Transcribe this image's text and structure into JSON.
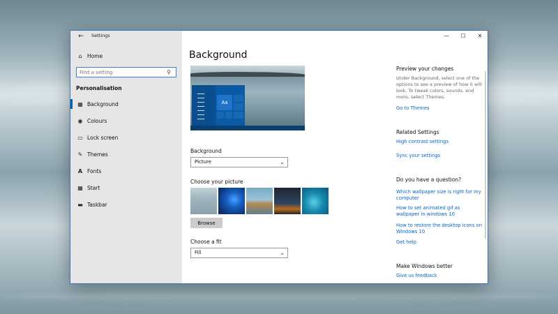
{
  "window": {
    "title": "Settings",
    "back_icon": "back-arrow-icon",
    "controls": [
      "minimize",
      "maximize",
      "close"
    ]
  },
  "sidebar": {
    "home_label": "Home",
    "search_placeholder": "Find a setting",
    "section_title": "Personalisation",
    "items": [
      {
        "label": "Background",
        "icon": "picture-icon",
        "active": true
      },
      {
        "label": "Colours",
        "icon": "palette-icon",
        "active": false
      },
      {
        "label": "Lock screen",
        "icon": "monitor-icon",
        "active": false
      },
      {
        "label": "Themes",
        "icon": "brush-icon",
        "active": false
      },
      {
        "label": "Fonts",
        "icon": "font-icon",
        "active": false
      },
      {
        "label": "Start",
        "icon": "start-grid-icon",
        "active": false
      },
      {
        "label": "Taskbar",
        "icon": "taskbar-icon",
        "active": false
      }
    ]
  },
  "main": {
    "title": "Background",
    "preview_tile_text": "Aa",
    "background_label": "Background",
    "background_value": "Picture",
    "choose_picture_label": "Choose your picture",
    "browse_label": "Browse",
    "fit_label": "Choose a fit",
    "fit_value": "Fill"
  },
  "right": {
    "preview_heading": "Preview your changes",
    "preview_text": "Under Background, select one of the options to see a preview of how it will look. To tweak colors, sounds, and more, select Themes.",
    "go_to_themes": "Go to Themes",
    "related_heading": "Related Settings",
    "high_contrast": "High contrast settings",
    "sync_settings": "Sync your settings",
    "question_heading": "Do you have a question?",
    "q1": "Which wallpaper size is right for my computer",
    "q2": "How to set animated gif as wallpaper in windows 10",
    "q3": "How to restore the desktop icons on Windows 10",
    "get_help": "Get help",
    "better_heading": "Make Windows better",
    "feedback": "Give us feedback"
  },
  "colors": {
    "accent": "#0066cc",
    "active_bar": "#0063b1",
    "sidebar_bg": "#e6e6e6"
  }
}
